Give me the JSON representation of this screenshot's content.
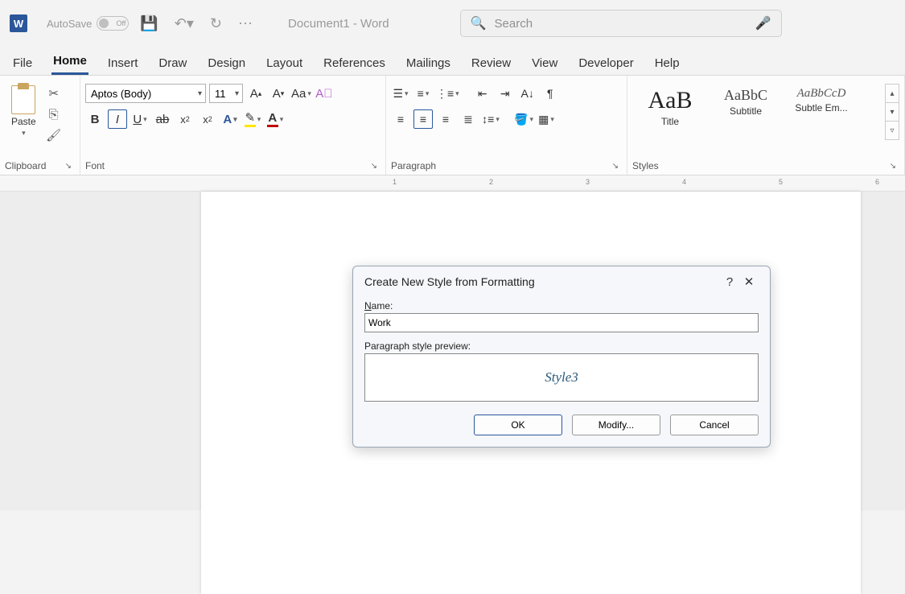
{
  "titlebar": {
    "autosave_label": "AutoSave",
    "autosave_state": "Off",
    "doc_title": "Document1  -  Word",
    "search_placeholder": "Search"
  },
  "tabs": {
    "file": "File",
    "home": "Home",
    "insert": "Insert",
    "draw": "Draw",
    "design": "Design",
    "layout": "Layout",
    "references": "References",
    "mailings": "Mailings",
    "review": "Review",
    "view": "View",
    "developer": "Developer",
    "help": "Help"
  },
  "ribbon": {
    "clipboard": {
      "label": "Clipboard",
      "paste": "Paste"
    },
    "font": {
      "label": "Font",
      "name": "Aptos (Body)",
      "size": "11"
    },
    "paragraph": {
      "label": "Paragraph"
    },
    "styles": {
      "label": "Styles",
      "items": [
        {
          "preview": "AaB",
          "name": "Title"
        },
        {
          "preview": "AaBbC",
          "name": "Subtitle"
        },
        {
          "preview": "AaBbCcD",
          "name": "Subtle Em..."
        }
      ]
    }
  },
  "ruler": {
    "marks": [
      "1",
      "2",
      "3",
      "4",
      "5",
      "6"
    ]
  },
  "dialog": {
    "title": "Create New Style from Formatting",
    "name_label_prefix": "N",
    "name_label_rest": "ame:",
    "name_value": "Work",
    "preview_label": "Paragraph style preview:",
    "preview_text": "Style3",
    "buttons": {
      "ok": "OK",
      "modify_prefix": "M",
      "modify_rest": "odify...",
      "cancel": "Cancel"
    }
  }
}
